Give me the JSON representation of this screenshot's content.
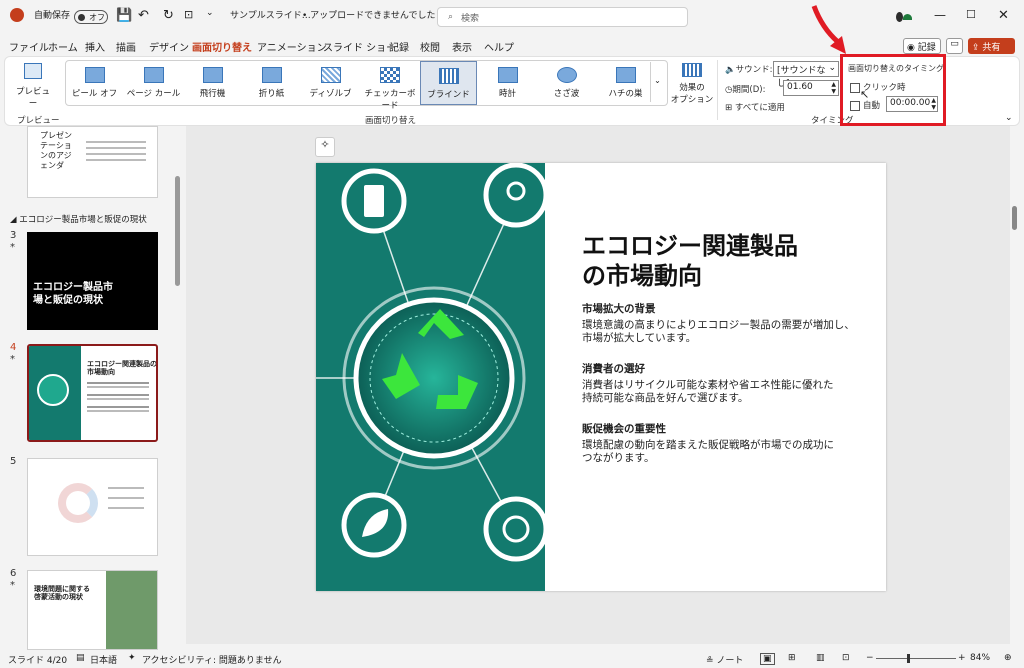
{
  "titlebar": {
    "autosave_label": "自動保存",
    "autosave_state": "オフ",
    "file_name": "サンプルスライド…",
    "upload_status": "• アップロードできませんでした",
    "search_placeholder": "検索"
  },
  "menu": {
    "tabs": [
      "ファイル",
      "ホーム",
      "挿入",
      "描画",
      "デザイン",
      "画面切り替え",
      "アニメーション",
      "スライド ショー",
      "記録",
      "校閲",
      "表示",
      "ヘルプ"
    ],
    "record_button": "記録",
    "share_button": "共有"
  },
  "ribbon": {
    "preview_label": "プレビュー",
    "preview_group": "プレビュー",
    "transitions": [
      "ピール オフ",
      "ページ カール",
      "飛行機",
      "折り紙",
      "ディゾルブ",
      "チェッカーボード",
      "ブラインド",
      "時計",
      "さざ波",
      "ハチの巣"
    ],
    "transition_group": "画面切り替え",
    "effect_options": "効果の\nオプション",
    "sound_label": "サウンド:",
    "sound_value": "[サウンドなし]",
    "duration_label": "期間(D):",
    "duration_value": "01.60",
    "apply_all": "すべてに適用",
    "timing_group": "タイミング",
    "timing_heading": "画面切り替えのタイミング",
    "on_click": "クリック時",
    "after": "自動",
    "after_value": "00:00.00"
  },
  "thumbnails": {
    "slide2_text": "プレゼンテーションのアジェンダ",
    "section_name": "エコロジー製品市場と販促の現状",
    "slide3_num": "3",
    "slide3_text": "エコロジー製品市場と販促の現状",
    "slide4_num": "4",
    "slide4_title": "エコロジー関連製品の市場動向",
    "slide5_num": "5",
    "slide6_num": "6",
    "slide6_text": "環境問題に関する啓蒙活動の現状"
  },
  "slide": {
    "title_line1": "エコロジー関連製品",
    "title_line2": "の市場動向",
    "s1_heading": "市場拡大の背景",
    "s1_body1": "環境意識の高まりによりエコロジー製品の需要が増加し、",
    "s1_body2": "市場が拡大しています。",
    "s2_heading": "消費者の選好",
    "s2_body1": "消費者はリサイクル可能な素材や省エネ性能に優れた",
    "s2_body2": "持続可能な商品を好んで選びます。",
    "s3_heading": "販促機会の重要性",
    "s3_body1": "環境配慮の動向を踏まえた販促戦略が市場での成功に",
    "s3_body2": "つながります。"
  },
  "status": {
    "slide_info": "スライド 4/20",
    "language": "日本語",
    "accessibility": "アクセシビリティ: 問題ありません",
    "notes": "ノート",
    "zoom": "84%"
  },
  "colors": {
    "accent": "#c43e1c",
    "teal": "#137a6e",
    "highlight": "#e01b24"
  }
}
